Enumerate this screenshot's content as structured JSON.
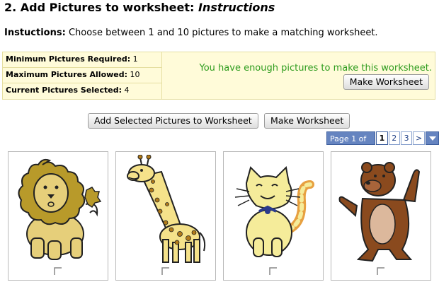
{
  "page": {
    "title_prefix": "2. Add Pictures to worksheet:",
    "title_emphasis": "Instructions"
  },
  "instructions": {
    "label": "Instuctions:",
    "text": "Choose between 1 and 10 pictures to make a matching worksheet."
  },
  "info": {
    "min_label": "Minimum Pictures Required:",
    "min_value": "1",
    "max_label": "Maximum Pictures Allowed:",
    "max_value": "10",
    "current_label": "Current Pictures Selected:",
    "current_value": "4",
    "status_message": "You have enough pictures to make this worksheet.",
    "status_color": "#2e9c1e",
    "make_button": "Make Worksheet"
  },
  "actions": {
    "add_selected": "Add Selected Pictures to Worksheet",
    "make_worksheet": "Make Worksheet"
  },
  "pager": {
    "label": "Page 1 of 3",
    "pages": [
      "1",
      "2",
      "3"
    ],
    "current": "1",
    "next": ">",
    "dropdown_icon": "triangle-down-icon"
  },
  "pictures": [
    {
      "name": "lion",
      "selected": false
    },
    {
      "name": "giraffe",
      "selected": false
    },
    {
      "name": "cat",
      "selected": false
    },
    {
      "name": "bear",
      "selected": false
    }
  ]
}
